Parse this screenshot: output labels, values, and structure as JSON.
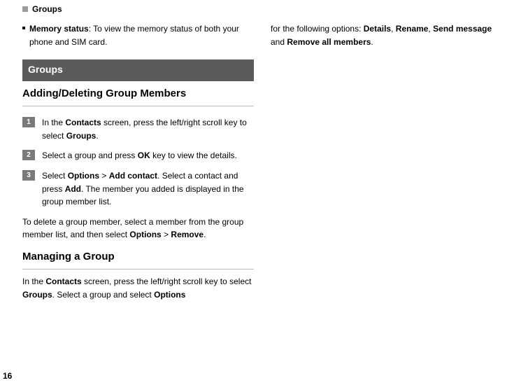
{
  "header": {
    "label": "Groups"
  },
  "memory": {
    "label_bold": "Memory status",
    "label_rest": ": To view the memory status of both your phone and SIM card."
  },
  "section_title": "Groups",
  "sub1": "Adding/Deleting Group Members",
  "steps": [
    {
      "n": "1",
      "pre": "In the ",
      "b1": "Contacts",
      "mid": " screen, press the left/right scroll key to select ",
      "b2": "Groups",
      "post": "."
    },
    {
      "n": "2",
      "pre": "Select a group and press ",
      "b1": "OK",
      "mid": " key to view the details.",
      "b2": "",
      "post": ""
    },
    {
      "n": "3",
      "pre": "Select ",
      "b1": "Options",
      "mid": " > ",
      "b2": "Add contact",
      "post": ". Select a contact and press ",
      "b3": "Add",
      "post2": ". The member you added is displayed in the group member list."
    }
  ],
  "delete_para": {
    "pre": "To delete a group member, select a member from the group member list, and then select ",
    "b1": "Options",
    "mid": " > ",
    "b2": "Remove",
    "post": "."
  },
  "sub2": "Managing a Group",
  "manage_para": {
    "pre": "In the ",
    "b1": "Contacts",
    "mid": " screen, press the left/right scroll key to select ",
    "b2": "Groups",
    "mid2": ". Select a group and select ",
    "b3": "Options"
  },
  "right_para": {
    "pre": "for the following options: ",
    "b1": "Details",
    "c1": ", ",
    "b2": "Rename",
    "c2": ", ",
    "b3": "Send message",
    "c3": " and ",
    "b4": "Remove all members",
    "post": "."
  },
  "page_number": "16"
}
